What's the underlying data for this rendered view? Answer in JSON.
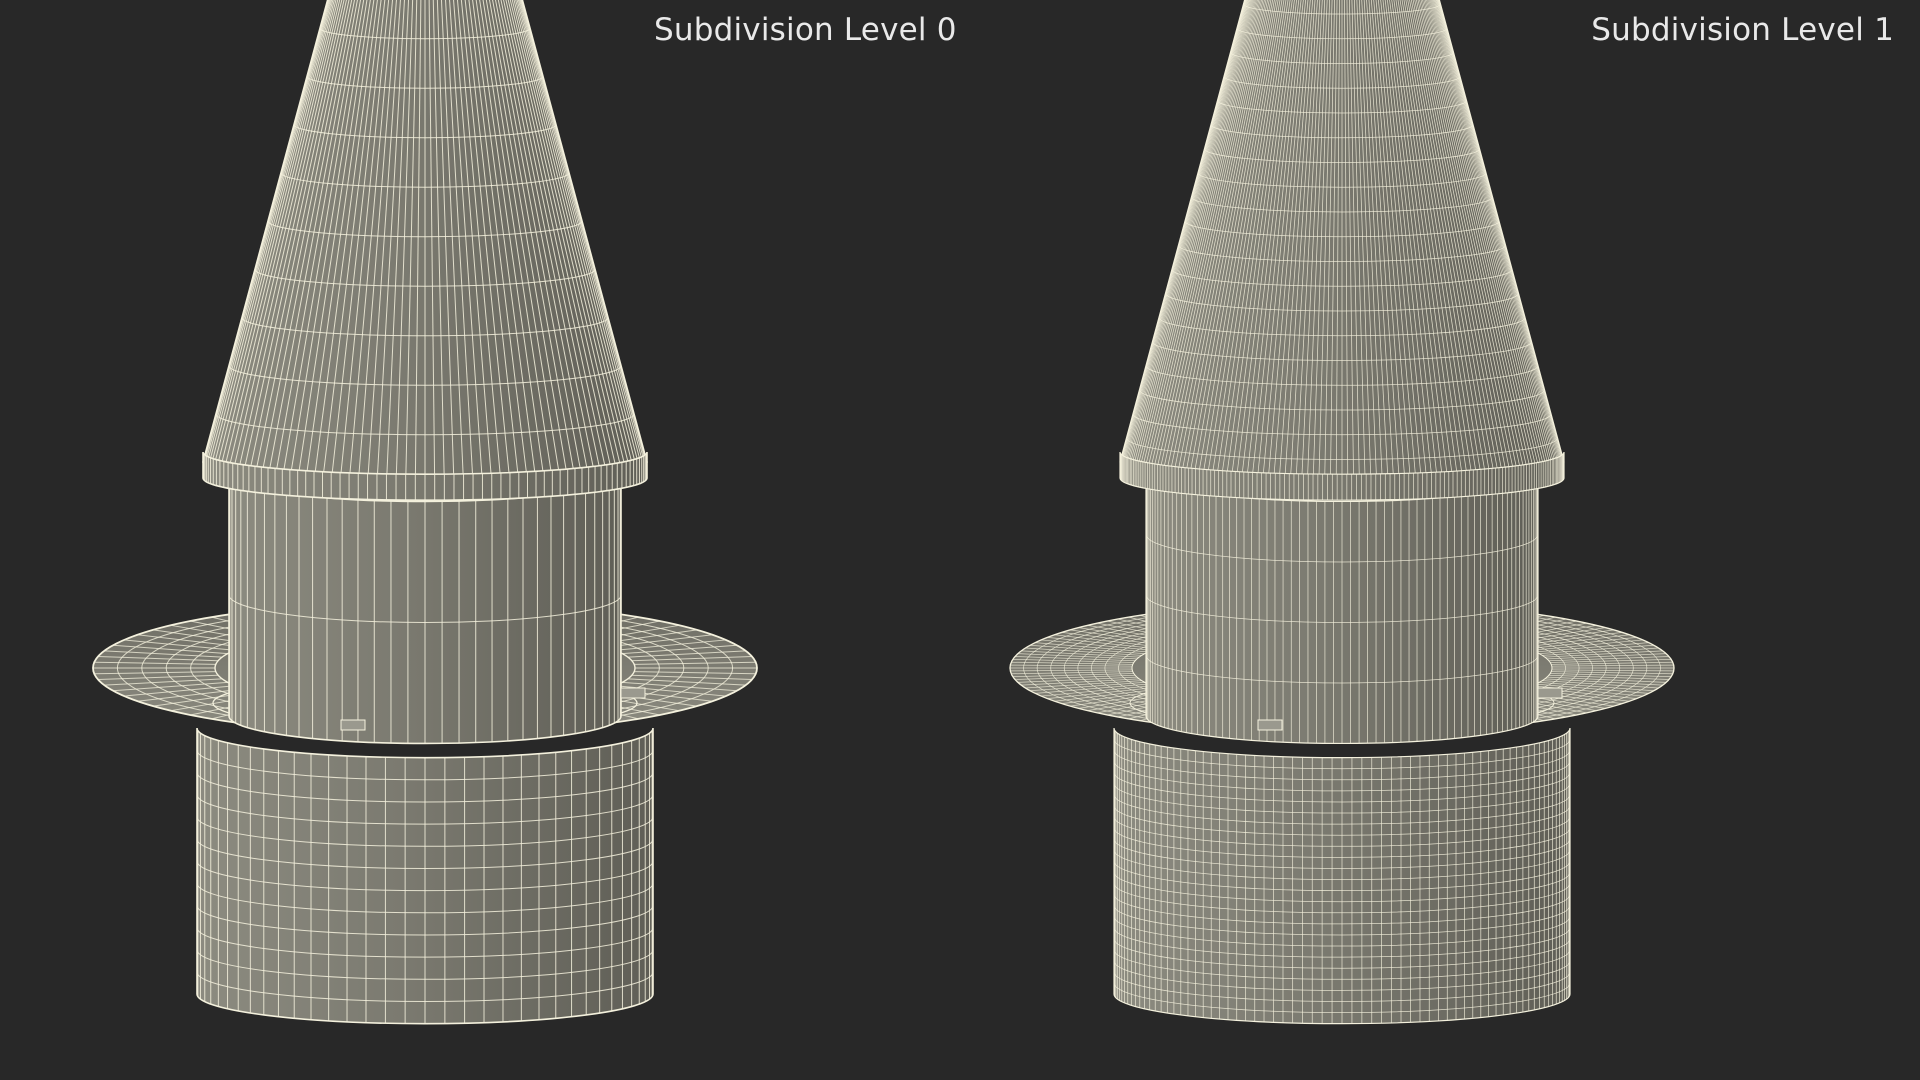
{
  "labels": {
    "left": "Subdivision Level 0",
    "right": "Subdivision Level 1"
  },
  "colors": {
    "background": "#282828",
    "surface": "#8e8d82",
    "surface_dark": "#6a695f",
    "wire": "#f4f1dd",
    "label": "#e9e9e9"
  },
  "models": [
    {
      "name": "subdivision-level-0",
      "density": 1
    },
    {
      "name": "subdivision-level-1",
      "density": 2
    }
  ]
}
